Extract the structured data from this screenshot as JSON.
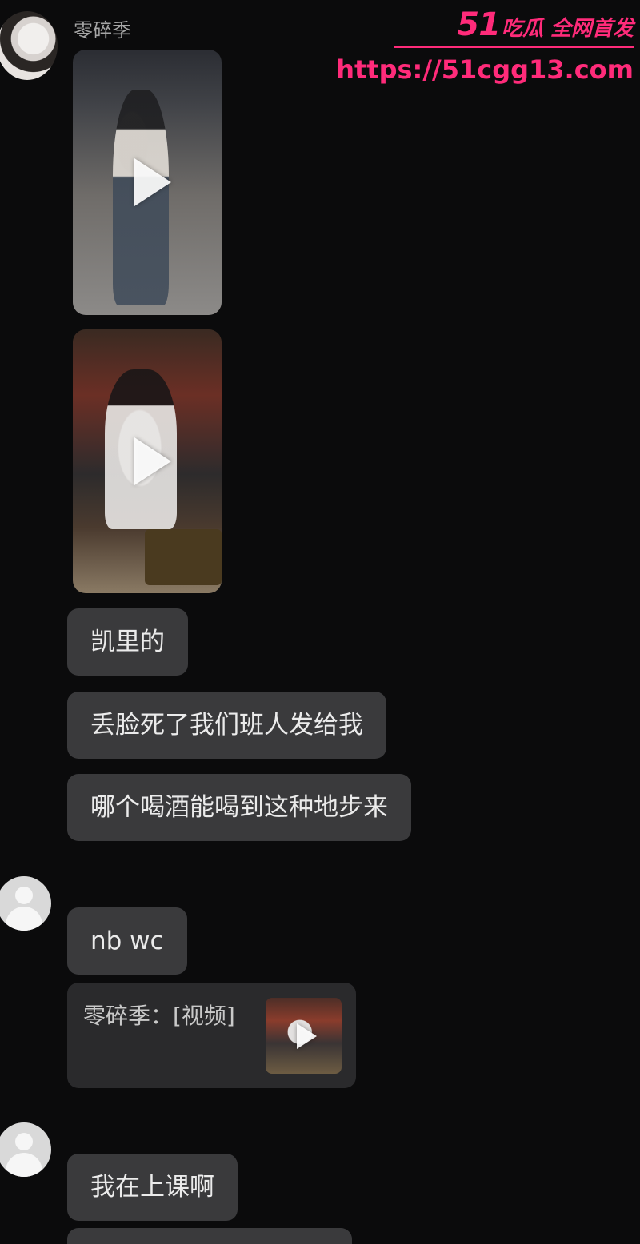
{
  "chat": {
    "sender_name": "零碎季",
    "messages": [
      {
        "text": "凯里的"
      },
      {
        "text": "丢脸死了我们班人发给我"
      },
      {
        "text": "哪个喝酒能喝到这种地步来"
      },
      {
        "text": "nb wc"
      },
      {
        "text": "我在上课啊"
      }
    ],
    "quote": {
      "text": "零碎季：[视频]"
    }
  },
  "watermark": {
    "logo_number": "51",
    "logo_tag": "吃瓜 全网首发",
    "url": "https://51cgg13.com"
  },
  "colors": {
    "background": "#0b0b0c",
    "bubble": "#3a3a3c",
    "watermark_accent": "#ff2b7a"
  }
}
